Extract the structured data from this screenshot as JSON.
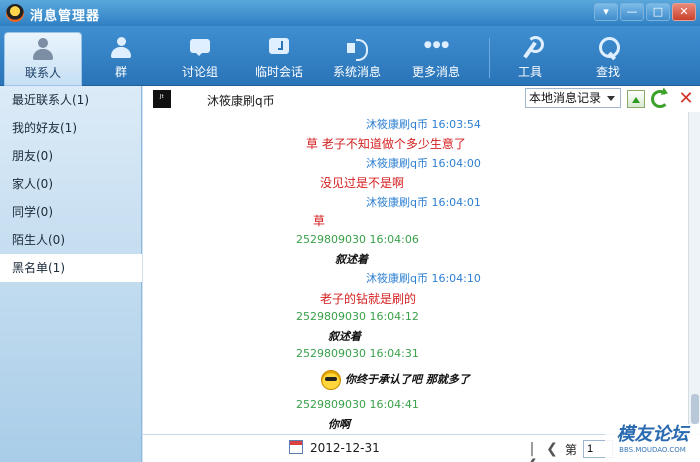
{
  "window": {
    "title": "消息管理器",
    "buttons": {
      "menu": "▾",
      "minimize": "—",
      "maximize": "□",
      "close": "✕"
    }
  },
  "toolbar": {
    "items": [
      {
        "label": "联系人",
        "icon": "user-icon",
        "active": true
      },
      {
        "label": "群",
        "icon": "group-icon"
      },
      {
        "label": "讨论组",
        "icon": "chat-icon"
      },
      {
        "label": "临时会话",
        "icon": "clock-chat-icon"
      },
      {
        "label": "系统消息",
        "icon": "speaker-icon"
      },
      {
        "label": "更多消息",
        "icon": "more-icon"
      },
      {
        "label": "工具",
        "icon": "wrench-icon"
      },
      {
        "label": "查找",
        "icon": "search-icon"
      }
    ]
  },
  "sidebar": {
    "items": [
      {
        "label": "最近联系人(1)"
      },
      {
        "label": "我的好友(1)"
      },
      {
        "label": "朋友(0)"
      },
      {
        "label": "家人(0)"
      },
      {
        "label": "同学(0)"
      },
      {
        "label": "陌生人(0)"
      },
      {
        "label": "黑名单(1)",
        "active": true
      }
    ]
  },
  "contact": {
    "avatar_text": "ᴶᵗ",
    "name": "沐筱康刷q币"
  },
  "filter": {
    "selected": "本地消息记录"
  },
  "messages": [
    {
      "meta": "沐筱康刷q币   16:03:54",
      "color": "blue"
    },
    {
      "text": "草 老子不知道做个多少生意了",
      "style": "red"
    },
    {
      "meta": "沐筱康刷q币   16:04:00",
      "color": "blue"
    },
    {
      "text": "没见过是不是啊",
      "style": "red"
    },
    {
      "meta": "沐筱康刷q币   16:04:01",
      "color": "blue"
    },
    {
      "text": "草",
      "style": "red"
    },
    {
      "meta": "2529809030  16:04:06",
      "color": "green"
    },
    {
      "text": "叙述着",
      "style": "italic"
    },
    {
      "meta": "沐筱康刷q币   16:04:10",
      "color": "blue"
    },
    {
      "text": "老子的钻就是刷的",
      "style": "red"
    },
    {
      "meta": "2529809030  16:04:12",
      "color": "green"
    },
    {
      "text": "叙述着",
      "style": "italic"
    },
    {
      "meta": "2529809030  16:04:31",
      "color": "green"
    },
    {
      "text": "你终于承认了吧 那就多了",
      "style": "italic"
    },
    {
      "meta": "2529809030  16:04:41",
      "color": "green"
    },
    {
      "text": "你啊",
      "style": "italic"
    }
  ],
  "footer": {
    "date": "2012-12-31",
    "page_prefix": "第",
    "page_value": "1",
    "first_label": "|❮",
    "prev_label": "❮"
  },
  "watermark": {
    "main": "模友论坛",
    "sub": "BBS.MOUDAO.COM"
  },
  "colors": {
    "accent": "#2f80c4",
    "meta_blue": "#2d7fd1",
    "meta_green": "#3aa14a",
    "red_text": "#d42020"
  }
}
